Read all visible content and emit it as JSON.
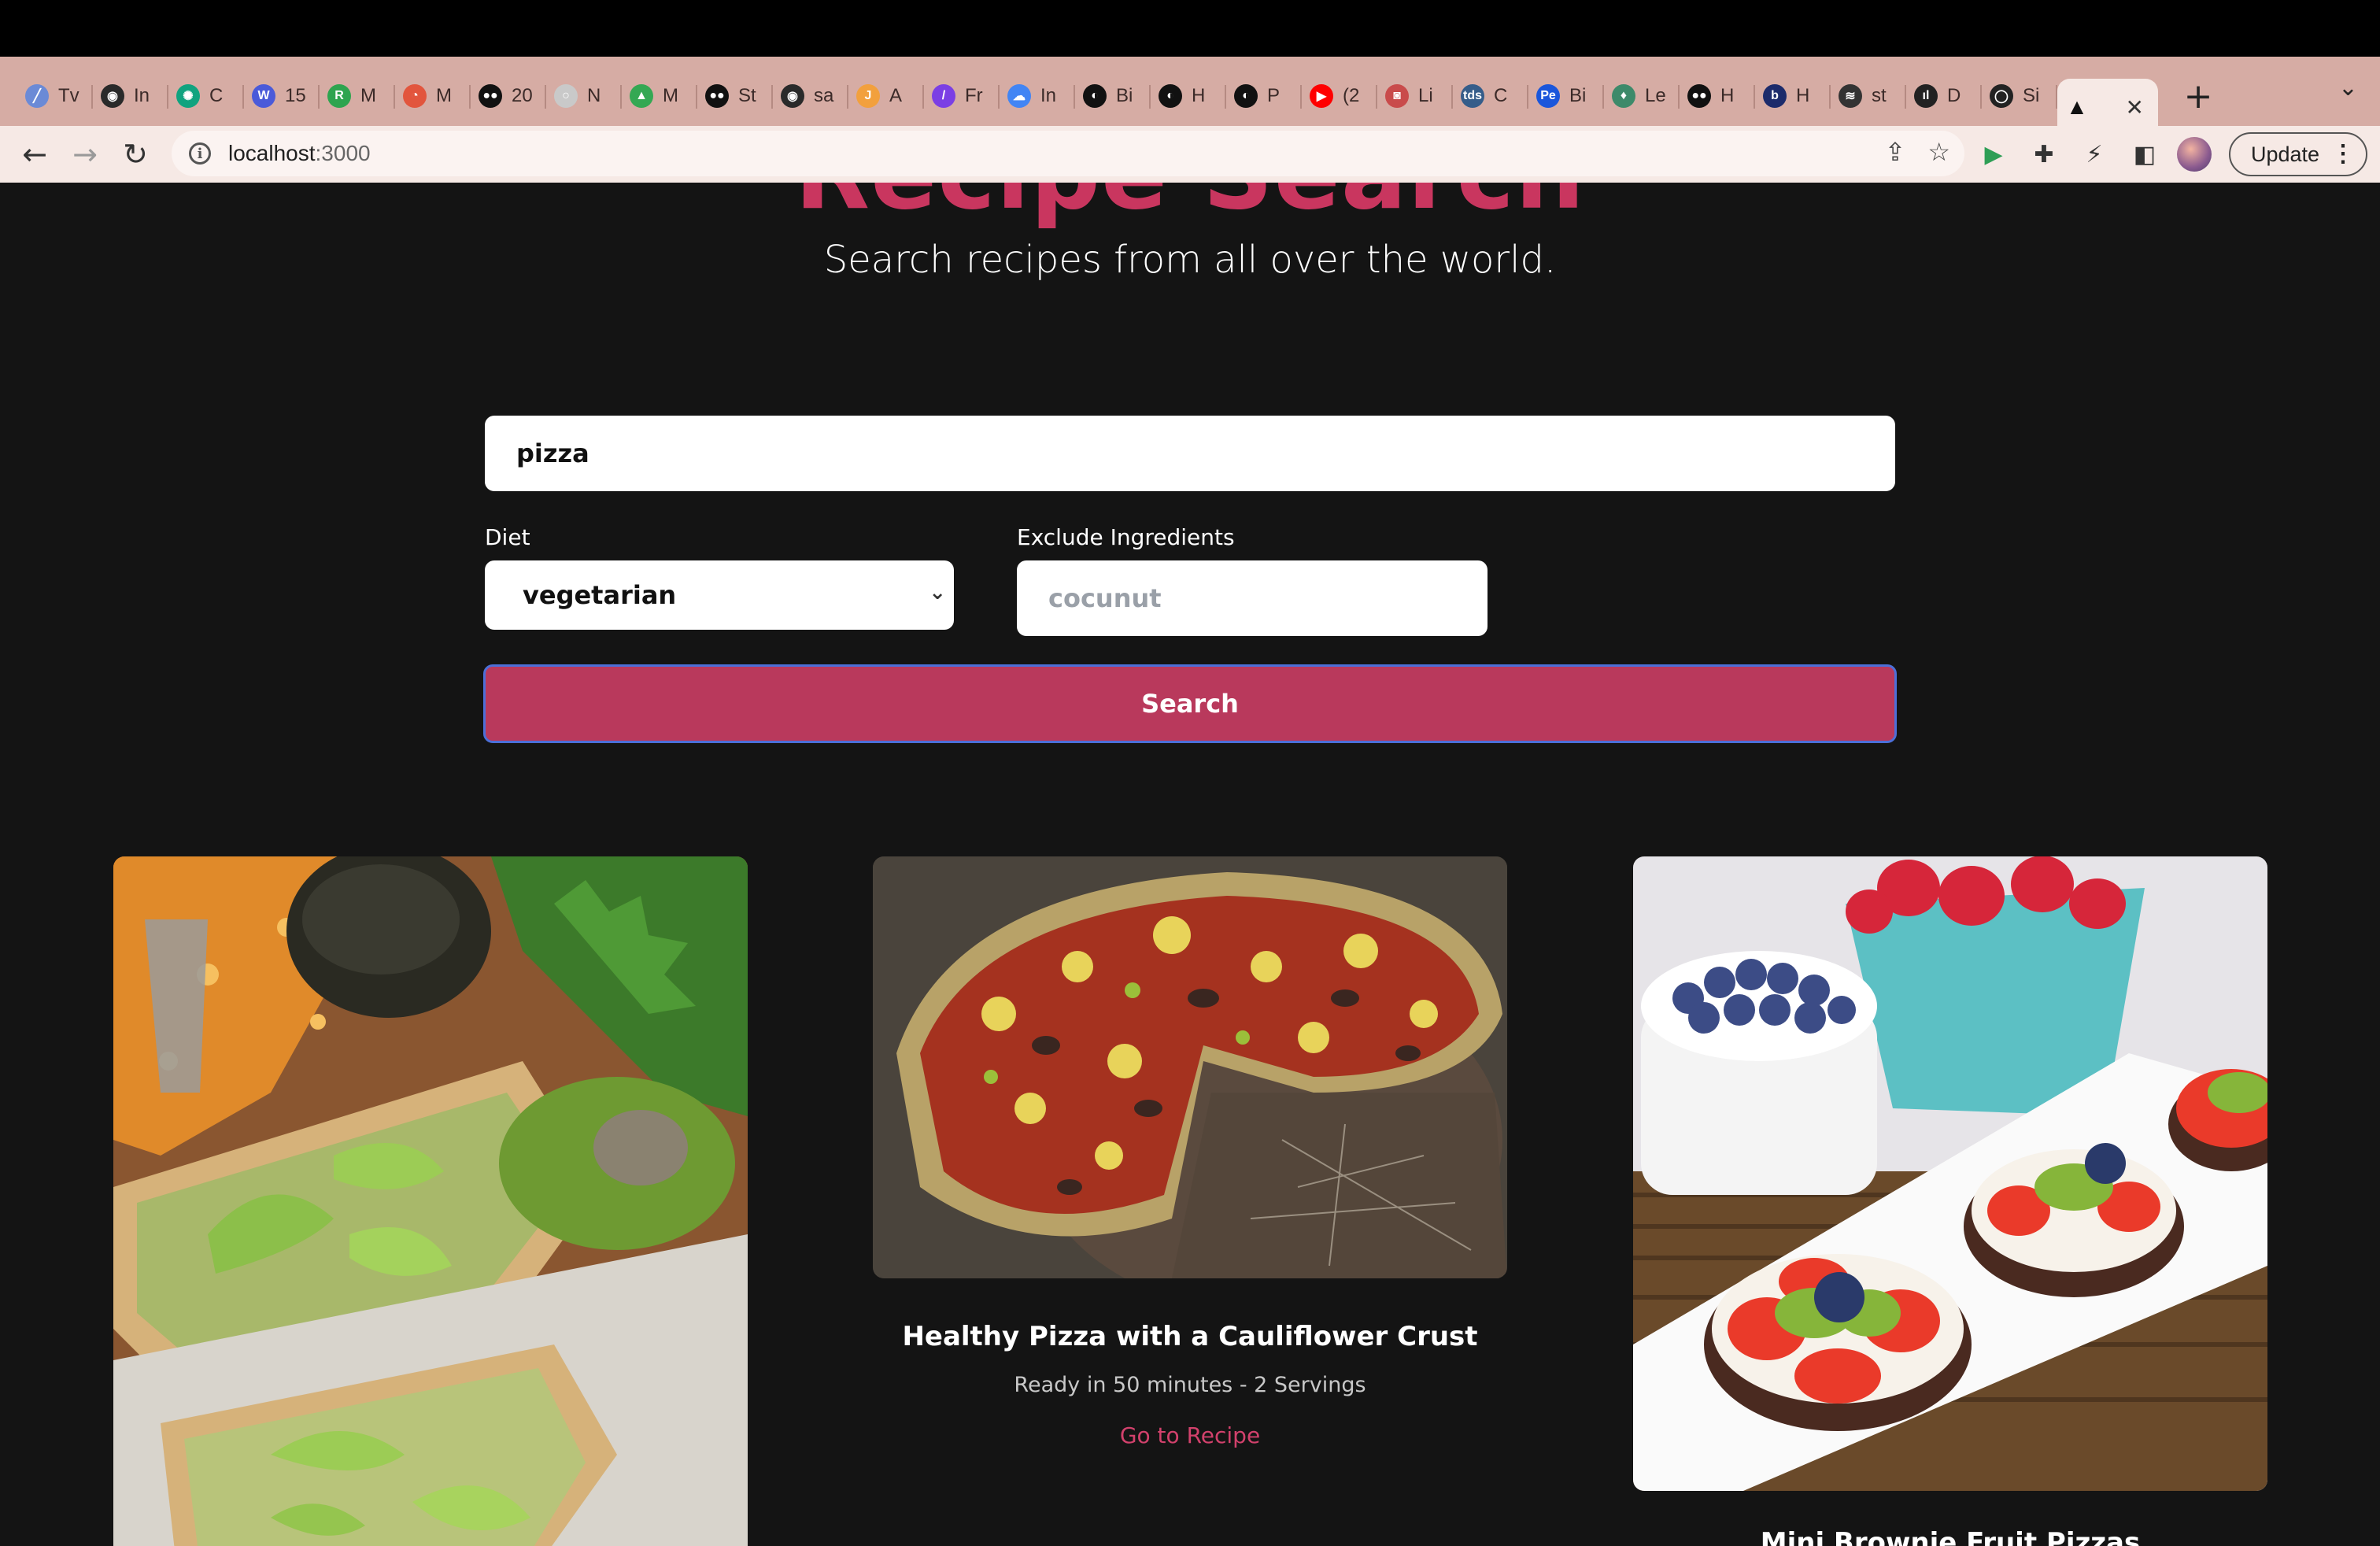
{
  "browser": {
    "tabs": [
      {
        "label": "Tv",
        "fav_color": "#6b8ad6",
        "glyph": "╱"
      },
      {
        "label": "In",
        "fav_color": "#2a2a2a",
        "glyph": "◉"
      },
      {
        "label": "C",
        "fav_color": "#10a37f",
        "glyph": "✺"
      },
      {
        "label": "15",
        "fav_color": "#4a5ad9",
        "glyph": "W"
      },
      {
        "label": "M",
        "fav_color": "#2ea44f",
        "glyph": "R"
      },
      {
        "label": "M",
        "fav_color": "#e2553d",
        "glyph": "◔"
      },
      {
        "label": "20",
        "fav_color": "#111111",
        "glyph": "●●"
      },
      {
        "label": "N",
        "fav_color": "#c9c9c9",
        "glyph": "○"
      },
      {
        "label": "M",
        "fav_color": "#34a853",
        "glyph": "▲"
      },
      {
        "label": "St",
        "fav_color": "#111111",
        "glyph": "●●"
      },
      {
        "label": "sa",
        "fav_color": "#2a2a2a",
        "glyph": "◉"
      },
      {
        "label": "A",
        "fav_color": "#f2a03d",
        "glyph": "J"
      },
      {
        "label": "Fr",
        "fav_color": "#7b3fe4",
        "glyph": "/"
      },
      {
        "label": "In",
        "fav_color": "#4285f4",
        "glyph": "☁"
      },
      {
        "label": "Bi",
        "fav_color": "#111111",
        "glyph": "◐"
      },
      {
        "label": "H",
        "fav_color": "#111111",
        "glyph": "◐"
      },
      {
        "label": "P",
        "fav_color": "#111111",
        "glyph": "◐"
      },
      {
        "label": "(2",
        "fav_color": "#ff0000",
        "glyph": "▶"
      },
      {
        "label": "Li",
        "fav_color": "#c94b4b",
        "glyph": "◙"
      },
      {
        "label": "C",
        "fav_color": "#355d8a",
        "glyph": "tds"
      },
      {
        "label": "Bi",
        "fav_color": "#1a56db",
        "glyph": "Pe"
      },
      {
        "label": "Le",
        "fav_color": "#3d8a6a",
        "glyph": "♦"
      },
      {
        "label": "H",
        "fav_color": "#111111",
        "glyph": "●●"
      },
      {
        "label": "H",
        "fav_color": "#1c2b6b",
        "glyph": "b"
      },
      {
        "label": "st",
        "fav_color": "#333333",
        "glyph": "≋"
      },
      {
        "label": "D",
        "fav_color": "#222222",
        "glyph": "ıl"
      },
      {
        "label": "Si",
        "fav_color": "#222222",
        "glyph": "◯"
      }
    ],
    "active_tab": {
      "glyph": "▲",
      "close": "✕"
    },
    "new_tab": "+",
    "tab_menu": "⌄",
    "url_host": "localhost",
    "url_port": ":3000",
    "update_label": "Update",
    "update_menu": "⋮"
  },
  "page": {
    "title": "Recipe Search",
    "subtitle": "Search recipes from all over the world.",
    "search_value": "pizza",
    "diet_label": "Diet",
    "diet_value": "vegetarian",
    "exclude_label": "Exclude Ingredients",
    "exclude_placeholder": "cocunut",
    "search_button": "Search",
    "accent_color": "#b9395c"
  },
  "results": [
    {
      "title": "",
      "meta": "",
      "link": ""
    },
    {
      "title": "Healthy Pizza with a Cauliflower Crust",
      "meta": "Ready in 50 minutes - 2 Servings",
      "link": "Go to Recipe"
    },
    {
      "title": "Mini Brownie Fruit Pizzas",
      "meta": "",
      "link": ""
    }
  ]
}
